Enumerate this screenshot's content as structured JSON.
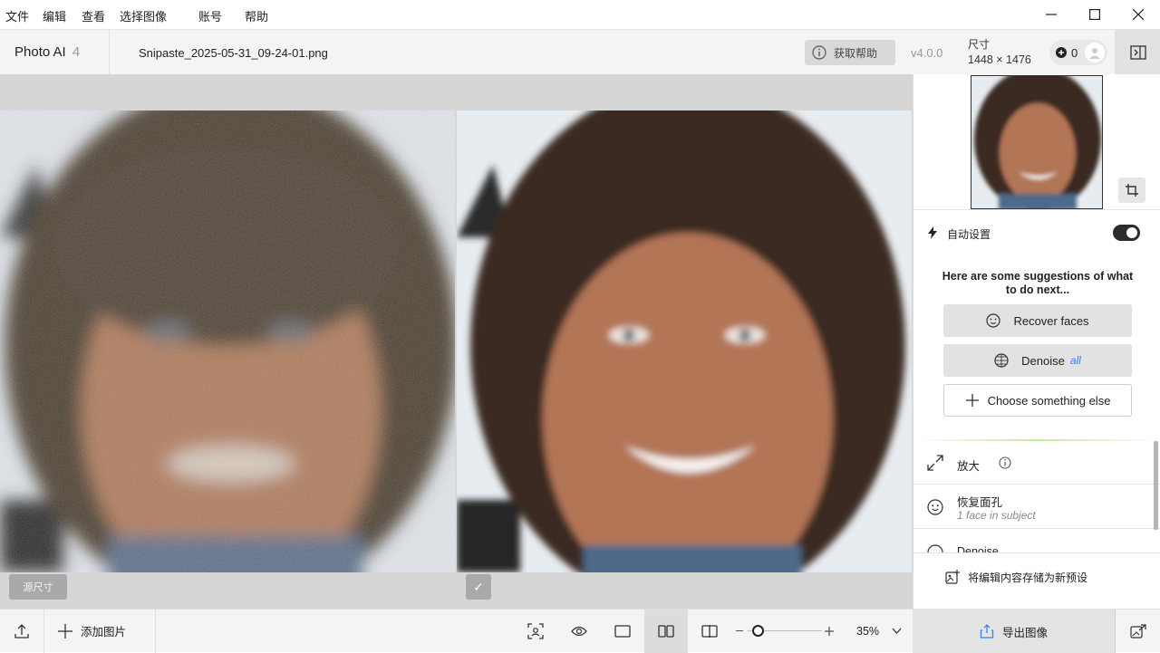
{
  "menu": {
    "file": "文件",
    "edit": "编辑",
    "view": "查看",
    "select_image": "选择图像",
    "account": "账号",
    "help": "帮助"
  },
  "header": {
    "app_name": "Photo AI",
    "app_version_badge": "4",
    "filename": "Snipaste_2025-05-31_09-24-01.png",
    "help_button": "获取帮助",
    "version": "v4.0.0",
    "size_label": "尺寸",
    "size_value": "1448 × 1476",
    "credits": "0"
  },
  "canvas": {
    "original_tag": "源尺寸",
    "processed_tag": "✓"
  },
  "panel": {
    "auto_settings": "自动设置",
    "auto_settings_enabled": true,
    "suggestion_title": "Here are some suggestions of what to do next...",
    "suggestions": {
      "recover_faces": "Recover faces",
      "denoise": "Denoise",
      "denoise_tag": "all",
      "choose_else": "Choose something else"
    },
    "tools": {
      "upscale": "放大",
      "recover_face_title": "恢复面孔",
      "recover_face_sub": "1 face in subject",
      "denoise_partial": "Denoise"
    },
    "save_preset": "将编辑内容存储为新预设"
  },
  "bottom": {
    "add_image": "添加图片",
    "zoom": "35%",
    "zoom_fraction": 0.14,
    "export": "导出图像"
  },
  "colors": {
    "accent_blue": "#3b82f6",
    "toggle_dark": "#2b2b2b"
  }
}
